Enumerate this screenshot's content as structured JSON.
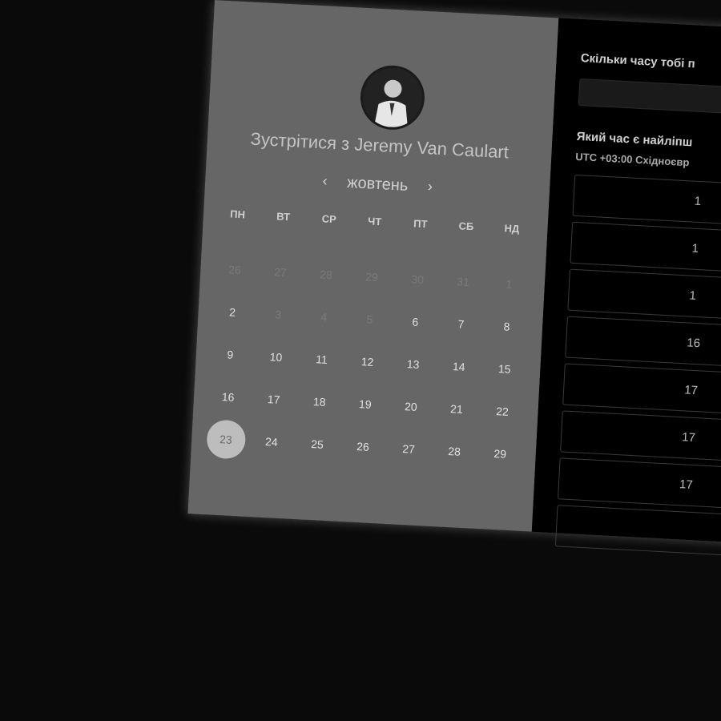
{
  "header": {
    "title": "Зустрітися з Jeremy Van Caulart",
    "month": "жовтень",
    "prev_arrow": "‹",
    "next_arrow": "›"
  },
  "weekdays": [
    "ПН",
    "ВТ",
    "СР",
    "ЧТ",
    "ПТ",
    "СБ",
    "НД"
  ],
  "days": [
    {
      "label": "26",
      "muted": true
    },
    {
      "label": "27",
      "muted": true
    },
    {
      "label": "28",
      "muted": true
    },
    {
      "label": "29",
      "muted": true
    },
    {
      "label": "30",
      "muted": true
    },
    {
      "label": "31",
      "muted": true
    },
    {
      "label": "1",
      "muted": true
    },
    {
      "label": "2"
    },
    {
      "label": "3",
      "muted": true
    },
    {
      "label": "4",
      "muted": true
    },
    {
      "label": "5",
      "muted": true
    },
    {
      "label": "6"
    },
    {
      "label": "7"
    },
    {
      "label": "8"
    },
    {
      "label": "9"
    },
    {
      "label": "10"
    },
    {
      "label": "11"
    },
    {
      "label": "12"
    },
    {
      "label": "13"
    },
    {
      "label": "14"
    },
    {
      "label": "15"
    },
    {
      "label": "16"
    },
    {
      "label": "17"
    },
    {
      "label": "18"
    },
    {
      "label": "19"
    },
    {
      "label": "20"
    },
    {
      "label": "21"
    },
    {
      "label": "22"
    },
    {
      "label": "23",
      "selected": true
    },
    {
      "label": "24"
    },
    {
      "label": "25"
    },
    {
      "label": "26"
    },
    {
      "label": "27"
    },
    {
      "label": "28"
    },
    {
      "label": "29"
    }
  ],
  "right": {
    "duration_label": "Скільки часу тобі п",
    "time_label": "Який час є найліпш",
    "timezone": "UTC +03:00 Східноєвр",
    "slots": [
      "1",
      "1",
      "1",
      "16",
      "17",
      "17",
      "17"
    ]
  },
  "colors": {
    "left_panel": "#666666",
    "right_panel": "#000000",
    "selected_day": "#bdbdbd"
  }
}
